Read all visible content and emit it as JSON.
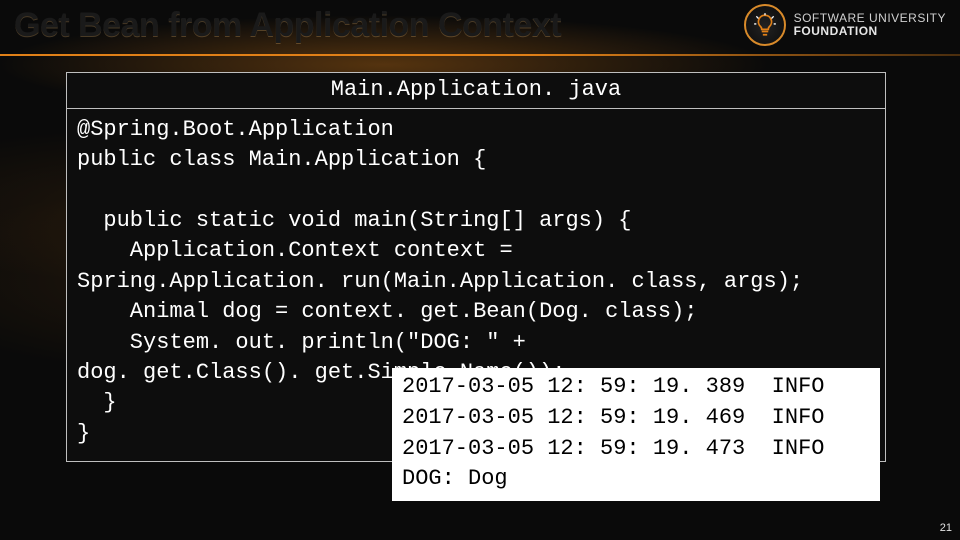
{
  "title": "Get Bean from Application Context",
  "logo": {
    "line1": "SOFTWARE UNIVERSITY",
    "line2": "FOUNDATION"
  },
  "code": {
    "filename": "Main.Application. java",
    "body": "@Spring.Boot.Application\npublic class Main.Application {\n\n  public static void main(String[] args) {\n    Application.Context context =\nSpring.Application. run(Main.Application. class, args);\n    Animal dog = context. get.Bean(Dog. class);\n    System. out. println(\"DOG: \" +\ndog. get.Class(). get.Simple.Name());\n  }\n}"
  },
  "console": "2017-03-05 12: 59: 19. 389  INFO\n2017-03-05 12: 59: 19. 469  INFO\n2017-03-05 12: 59: 19. 473  INFO\nDOG: Dog",
  "page_number": "21"
}
